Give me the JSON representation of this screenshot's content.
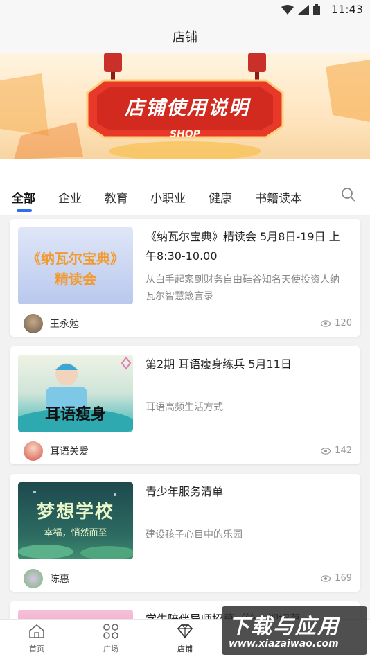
{
  "status": {
    "time": "11:43"
  },
  "appbar": {
    "title": "店铺"
  },
  "banner": {
    "title": "店铺使用说明",
    "subtitle": "SHOP"
  },
  "tabs": [
    "全部",
    "企业",
    "教育",
    "小职业",
    "健康",
    "书籍读本"
  ],
  "active_tab": "全部",
  "cards": [
    {
      "title": "《纳瓦尔宝典》精读会 5月8日-19日 上午8:30-10.00",
      "desc": "从白手起家到财务自由硅谷知名天使投资人纳瓦尔智慧箴言录",
      "author": "王永勉",
      "views": "120",
      "thumb_text": "《纳瓦尔宝典》\n精读会"
    },
    {
      "title": "第2期 耳语瘦身练兵 5月11日",
      "desc": "耳语高频生活方式",
      "author": "耳语关爱",
      "views": "142",
      "thumb_text": "耳语瘦身"
    },
    {
      "title": "青少年服务清单",
      "desc": "建设孩子心目中的乐园",
      "author": "陈惠",
      "views": "169",
      "thumb_text": "梦想学校",
      "thumb_sub": "幸福，悄然而至"
    },
    {
      "title": "学生陪伴导师招募（第一期招募"
    }
  ],
  "nav": [
    {
      "label": "首页",
      "icon": "home-icon"
    },
    {
      "label": "广场",
      "icon": "grid-icon"
    },
    {
      "label": "店铺",
      "icon": "diamond-icon"
    }
  ],
  "watermark": {
    "main": "下载与应用",
    "sub": "www.xiazaiwao.com"
  },
  "colors": {
    "accent": "#2f6fe8",
    "banner_red": "#e8382a"
  }
}
